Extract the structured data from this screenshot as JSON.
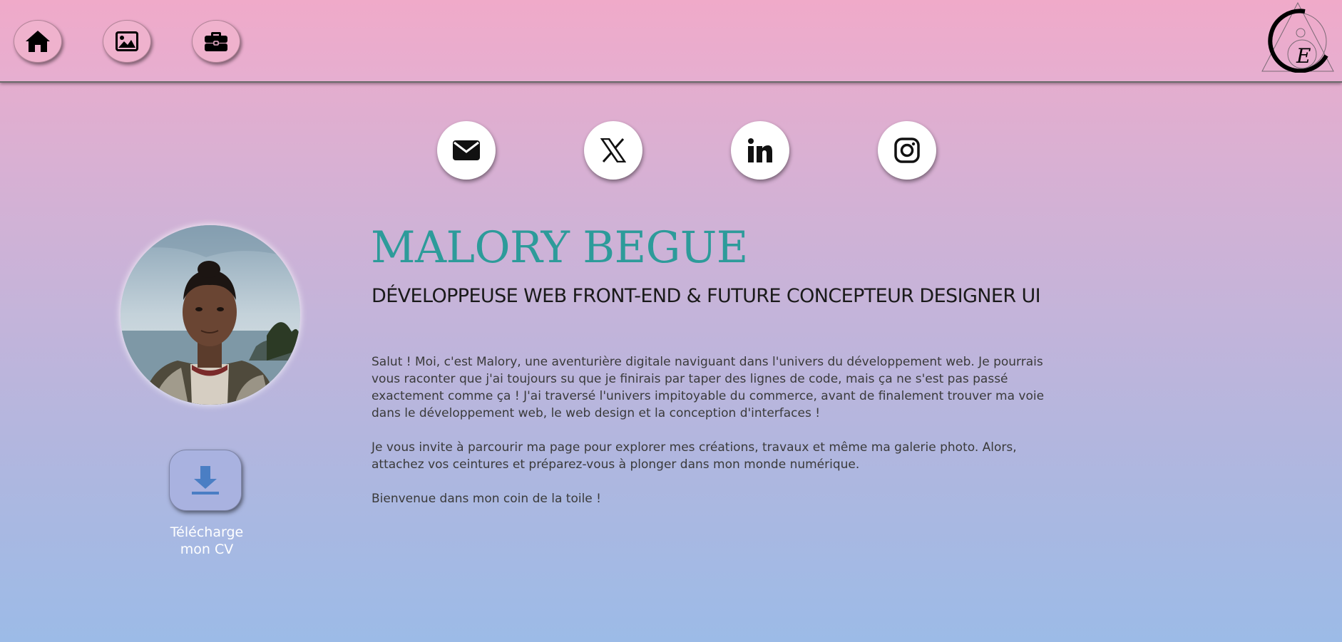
{
  "header": {
    "nav": [
      {
        "icon": "home-icon",
        "label": "Accueil"
      },
      {
        "icon": "image-icon",
        "label": "Galerie"
      },
      {
        "icon": "briefcase-icon",
        "label": "Travaux"
      }
    ],
    "logo_letter": "E"
  },
  "social": [
    {
      "icon": "envelope-icon"
    },
    {
      "icon": "x-icon"
    },
    {
      "icon": "linkedin-icon"
    },
    {
      "icon": "instagram-icon"
    }
  ],
  "profile": {
    "name": "MALORY BEGUE",
    "subtitle": "DÉVELOPPEUSE WEB FRONT-END & FUTURE CONCEPTEUR DESIGNER UI",
    "paragraphs": [
      "Salut ! Moi, c'est Malory, une aventurière digitale naviguant dans l'univers du développement web. Je pourrais vous raconter que j'ai toujours su que je finirais par taper des lignes de code, mais ça ne s'est pas passé exactement comme ça ! J'ai traversé l'univers impitoyable du commerce, avant de finalement trouver ma voie dans le développement web, le web design et la conception d'interfaces !",
      "Je vous invite à parcourir ma page pour explorer mes créations, travaux et même ma galerie photo. Alors, attachez vos ceintures et préparez-vous à plonger dans mon monde numérique.",
      "Bienvenue dans mon coin de la toile !"
    ]
  },
  "cv": {
    "label_line1": "Télécharge",
    "label_line2": "mon CV"
  },
  "colors": {
    "accent": "#2d9b9a",
    "header_bg": "#f0aac9",
    "download_icon": "#4a7ec4"
  }
}
